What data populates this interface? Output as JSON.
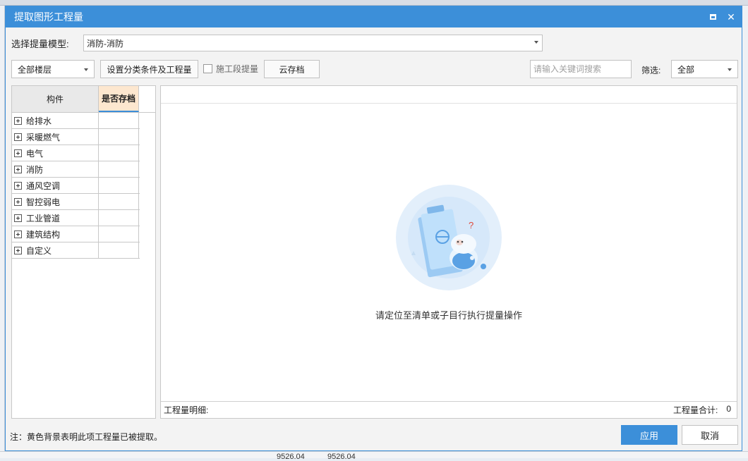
{
  "dialog": {
    "title": "提取图形工程量"
  },
  "model_select": {
    "label": "选择提量模型:",
    "value": "消防-消防"
  },
  "toolbar": {
    "floor_select": "全部楼层",
    "set_conditions_button": "设置分类条件及工程量",
    "stage_checkbox_label": "施工段提量",
    "cloud_save_button": "云存档",
    "search_placeholder": "请输入关键词搜索",
    "filter_label": "筛选:",
    "filter_value": "全部"
  },
  "tree": {
    "col_name": "构件",
    "col_saved": "是否存档",
    "items": [
      {
        "label": "给排水"
      },
      {
        "label": "采暖燃气"
      },
      {
        "label": "电气"
      },
      {
        "label": "消防"
      },
      {
        "label": "通风空调"
      },
      {
        "label": "智控弱电"
      },
      {
        "label": "工业管道"
      },
      {
        "label": "建筑结构"
      },
      {
        "label": "自定义"
      }
    ]
  },
  "detail": {
    "empty_message": "请定位至清单或子目行执行提量操作",
    "footer_left": "工程量明细:",
    "footer_total_label": "工程量合计:",
    "footer_total_value": "0"
  },
  "footer": {
    "note": "注：黄色背景表明此项工程量已被提取。",
    "apply_button": "应用",
    "cancel_button": "取消"
  },
  "background": {
    "num1": "9526.04",
    "num2": "9526.04"
  },
  "colors": {
    "accent": "#3c8fd9",
    "saved_header": "#fde7cf"
  }
}
